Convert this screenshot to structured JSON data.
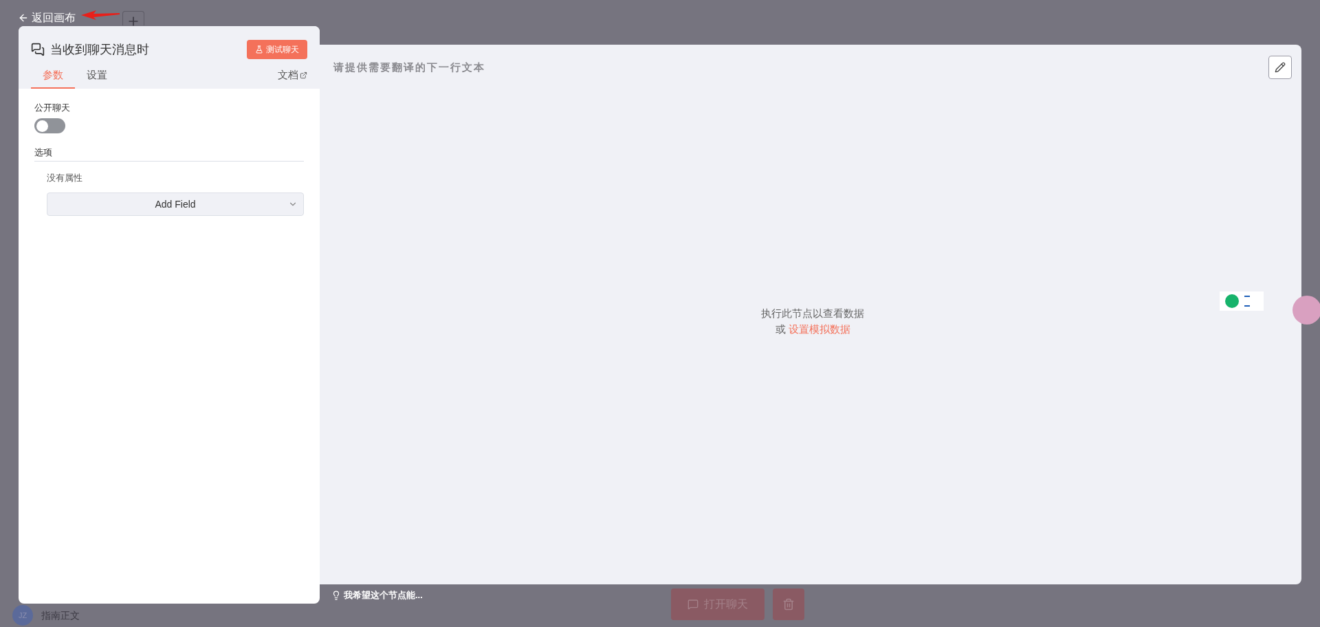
{
  "back_link": {
    "label": "返回画布"
  },
  "node_panel": {
    "title": "当收到聊天消息时",
    "test_button": "测试聊天",
    "tabs": [
      {
        "label": "参数",
        "selected": true
      },
      {
        "label": "设置",
        "selected": false
      }
    ],
    "docs_link": "文档",
    "public_chat": {
      "label": "公开聊天",
      "on": false
    },
    "options": {
      "label": "选项",
      "empty_text": "没有属性",
      "add_field": "Add Field"
    }
  },
  "output_panel": {
    "title": "请提供需要翻译的下一行文本",
    "empty_message": "执行此节点以查看数据",
    "or_text": "或",
    "mock_link": "设置模拟数据"
  },
  "feedback": {
    "label": "我希望这个节点能..."
  },
  "background": {
    "user": {
      "initials": "JZ",
      "name": "指南正文"
    },
    "open_chat_button": "打开聊天"
  }
}
